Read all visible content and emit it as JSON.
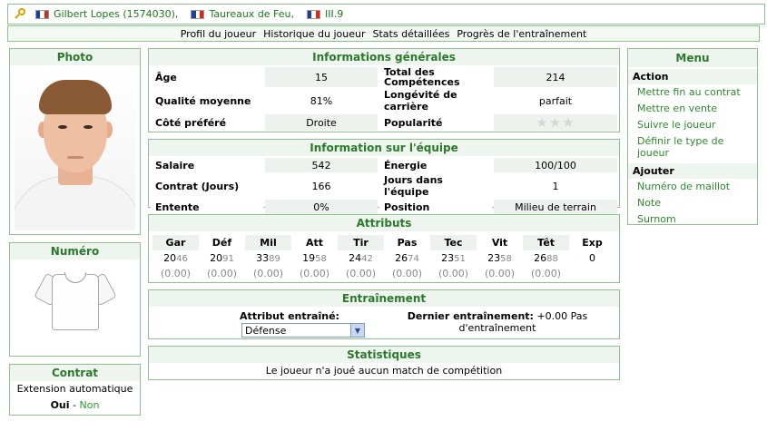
{
  "topbar": {
    "player": "Gilbert Lopes (1574030),",
    "team": "Taureaux de Feu,",
    "league": "III.9"
  },
  "subnav": [
    "Profil du joueur",
    "Historique du joueur",
    "Stats détaillées",
    "Progrès de l'entraînement"
  ],
  "photo": {
    "title": "Photo"
  },
  "numero": {
    "title": "Numéro"
  },
  "contrat": {
    "title": "Contrat",
    "extension": "Extension automatique",
    "oui": "Oui",
    "sep": " - ",
    "non": "Non"
  },
  "info_generales": {
    "title": "Informations générales",
    "rows": [
      {
        "l1": "Âge",
        "v1": "15",
        "l2": "Total des Compétences",
        "v2": "214"
      },
      {
        "l1": "Qualité moyenne",
        "v1": "81%",
        "l2": "Longévité de carrière",
        "v2": "parfait"
      },
      {
        "l1": "Côté préféré",
        "v1": "Droite",
        "l2": "Popularité"
      }
    ],
    "popularity_stars": 0,
    "popularity_max": 3
  },
  "info_equipe": {
    "title": "Information sur l'équipe",
    "rows": [
      {
        "l1": "Salaire",
        "v1": "542",
        "l2": "Énergie",
        "v2": "100/100"
      },
      {
        "l1": "Contrat (Jours)",
        "v1": "166",
        "l2": "Jours dans l'équipe",
        "v2": "1"
      },
      {
        "l1": "Entente",
        "v1": "0%",
        "l2": "Position",
        "v2": "Milieu de terrain"
      }
    ]
  },
  "attributs": {
    "title": "Attributs",
    "cols": [
      {
        "h": "Gar",
        "main": "20",
        "dec": "46",
        "diff": "(0.00)"
      },
      {
        "h": "Déf",
        "main": "20",
        "dec": "91",
        "diff": "(0.00)"
      },
      {
        "h": "Mil",
        "main": "33",
        "dec": "89",
        "diff": "(0.00)"
      },
      {
        "h": "Att",
        "main": "19",
        "dec": "58",
        "diff": "(0.00)"
      },
      {
        "h": "Tir",
        "main": "24",
        "dec": "42",
        "diff": "(0.00)"
      },
      {
        "h": "Pas",
        "main": "26",
        "dec": "74",
        "diff": "(0.00)"
      },
      {
        "h": "Tec",
        "main": "23",
        "dec": "51",
        "diff": "(0.00)"
      },
      {
        "h": "Vit",
        "main": "23",
        "dec": "58",
        "diff": "(0.00)"
      },
      {
        "h": "Têt",
        "main": "26",
        "dec": "88",
        "diff": "(0.00)"
      },
      {
        "h": "Exp",
        "main": "0",
        "dec": "",
        "diff": ""
      }
    ]
  },
  "entrainement": {
    "title": "Entraînement",
    "attr_label": "Attribut entraîné:",
    "attr_value": "Défense",
    "last_label": "Dernier entraînement:",
    "last_value": "+0.00 Pas d'entraînement"
  },
  "statistiques": {
    "title": "Statistiques",
    "text": "Le joueur n'a joué aucun match de compétition"
  },
  "menu": {
    "title": "Menu",
    "action_title": "Action",
    "action_items": [
      "Mettre fin au contrat",
      "Mettre en vente",
      "Suivre le joueur",
      "Définir le type de joueur"
    ],
    "ajouter_title": "Ajouter",
    "ajouter_items": [
      "Numéro de maillot",
      "Note",
      "Surnom"
    ]
  },
  "colors": {
    "border": "#8fc18f",
    "title_green": "#2b7a2b",
    "link_green": "#2b8a2b"
  }
}
